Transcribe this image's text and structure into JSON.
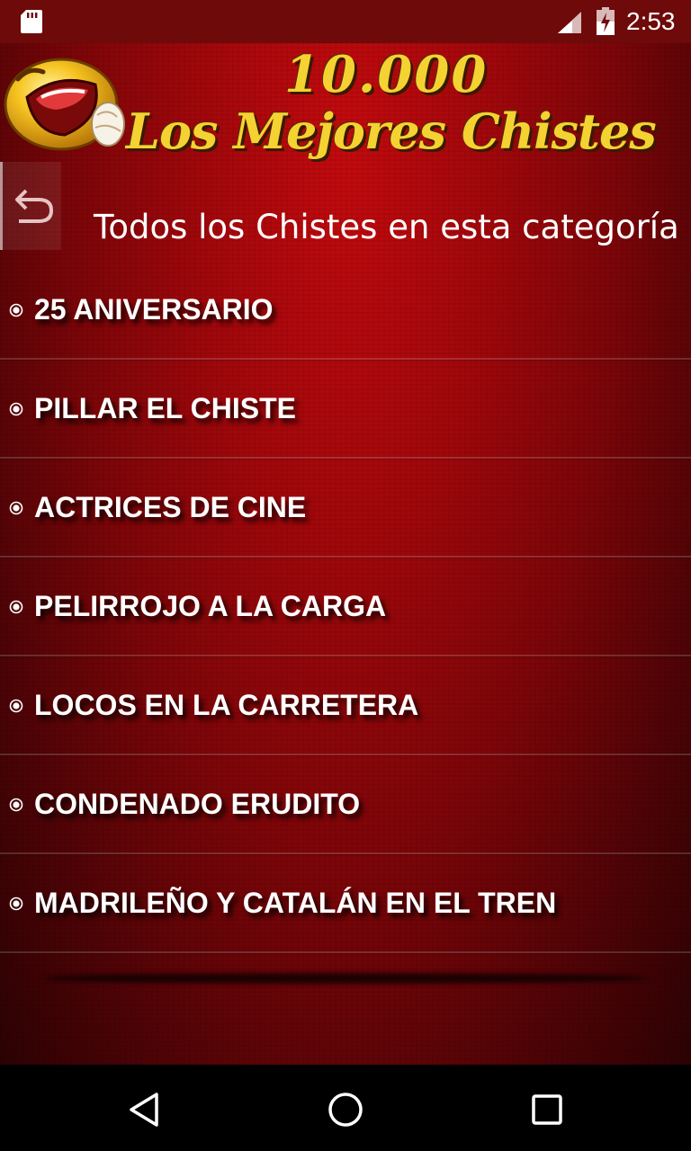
{
  "status_bar": {
    "time": "2:53",
    "icons": [
      "sd-card-icon",
      "signal-icon",
      "battery-icon"
    ],
    "background": "#6e0a0a"
  },
  "banner": {
    "line1": "10.000",
    "line2": "Los Mejores Chistes",
    "text_color": "#f4d232",
    "icon": "laughing-face-icon"
  },
  "header": {
    "back_icon": "back-arrow-icon",
    "title": "Todos los Chistes en esta categoría"
  },
  "list": {
    "bullet_icon": "radio-bullet-icon",
    "items": [
      {
        "label": "25 ANIVERSARIO"
      },
      {
        "label": "PILLAR EL CHISTE"
      },
      {
        "label": "ACTRICES DE CINE"
      },
      {
        "label": "PELIRROJO A LA CARGA"
      },
      {
        "label": "LOCOS EN LA CARRETERA"
      },
      {
        "label": "CONDENADO ERUDITO"
      },
      {
        "label": "MADRILEÑO Y CATALÁN EN EL TREN"
      }
    ]
  },
  "nav_bar": {
    "icons": [
      "nav-back-icon",
      "nav-home-icon",
      "nav-recents-icon"
    ]
  },
  "colors": {
    "background_red": "#a2070b",
    "text_white": "#ffffff"
  }
}
